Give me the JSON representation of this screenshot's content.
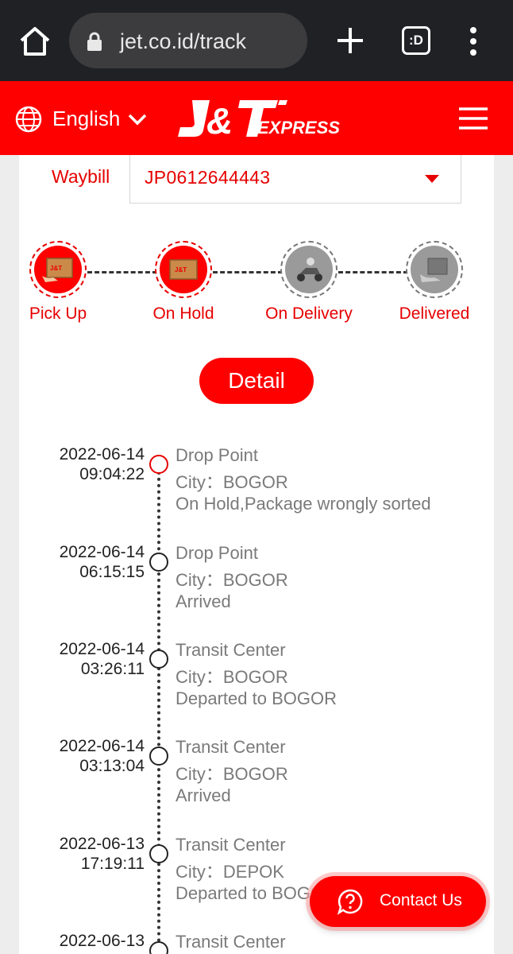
{
  "browser": {
    "url": "jet.co.id/track",
    "tabs_label": ":D"
  },
  "header": {
    "language": "English",
    "brand_colour": "#ff0000"
  },
  "waybill": {
    "label": "Waybill",
    "value": "JP0612644443"
  },
  "steps": [
    {
      "label": "Pick Up",
      "active": true
    },
    {
      "label": "On Hold",
      "active": true
    },
    {
      "label": "On Delivery",
      "active": false
    },
    {
      "label": "Delivered",
      "active": false
    }
  ],
  "detail_button": "Detail",
  "timeline": [
    {
      "date": "2022-06-14",
      "time": "09:04:22",
      "place": "Drop Point",
      "city": "City：BOGOR",
      "status": "On Hold,Package wrongly sorted",
      "active": true
    },
    {
      "date": "2022-06-14",
      "time": "06:15:15",
      "place": "Drop Point",
      "city": "City：BOGOR",
      "status": "Arrived",
      "active": false
    },
    {
      "date": "2022-06-14",
      "time": "03:26:11",
      "place": "Transit Center",
      "city": "City：BOGOR",
      "status": "Departed to BOGOR",
      "active": false
    },
    {
      "date": "2022-06-14",
      "time": "03:13:04",
      "place": "Transit Center",
      "city": "City：BOGOR",
      "status": "Arrived",
      "active": false
    },
    {
      "date": "2022-06-13",
      "time": "17:19:11",
      "place": "Transit Center",
      "city": "City：DEPOK",
      "status": "Departed to BOGOR",
      "active": false
    },
    {
      "date": "2022-06-13",
      "time": "",
      "place": "Transit Center",
      "city": "",
      "status": "",
      "active": false
    }
  ],
  "contact": {
    "label": "Contact Us"
  }
}
